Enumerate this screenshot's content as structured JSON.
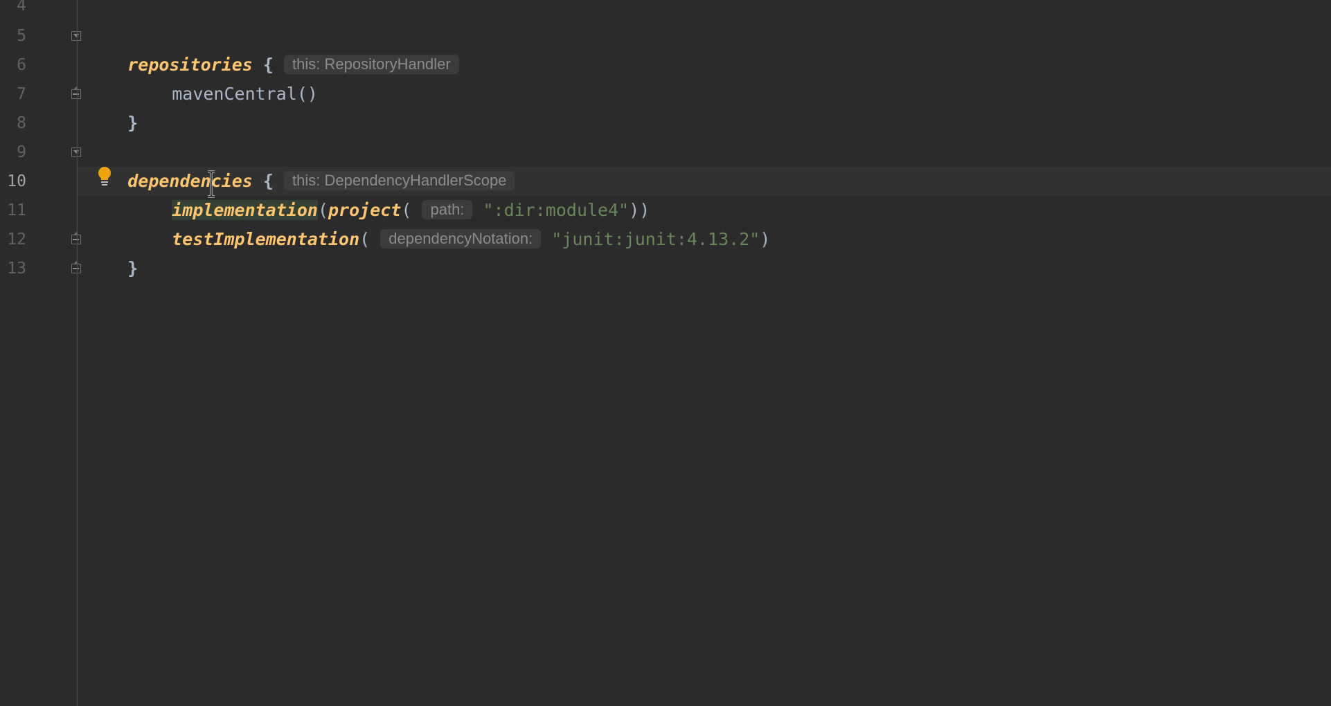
{
  "editor": {
    "line_numbers": [
      "4",
      "5",
      "6",
      "7",
      "8",
      "9",
      "10",
      "11",
      "12",
      "13"
    ],
    "current_line": "10",
    "lines": {
      "l5": {
        "fn": "repositories",
        "brace": "{",
        "hint": "this: RepositoryHandler"
      },
      "l6": {
        "fn": "mavenCentral()"
      },
      "l7": {
        "brace": "}"
      },
      "l9": {
        "fn": "dependencies",
        "brace": "{",
        "hint": "this: DependencyHandlerScope"
      },
      "l10": {
        "fn": "implementation",
        "open_paren": "(",
        "inner_fn": "project",
        "inner_open": "(",
        "hint": "path:",
        "arg": "\":dir:module4\"",
        "close": "))"
      },
      "l11": {
        "fn": "testImplementation",
        "open_paren": "(",
        "hint": "dependencyNotation:",
        "arg": "\"junit:junit:4.13.2\"",
        "close": ")"
      },
      "l12": {
        "brace": "}"
      }
    },
    "colors": {
      "background": "#2b2b2b",
      "function": "#ffc66d",
      "string": "#6a8759",
      "text": "#a9b7c6",
      "line_number": "#606366",
      "intention_bulb": "#f0a30a"
    },
    "icons": {
      "intention": "lightbulb-icon",
      "cursor": "text-cursor-icon"
    }
  }
}
